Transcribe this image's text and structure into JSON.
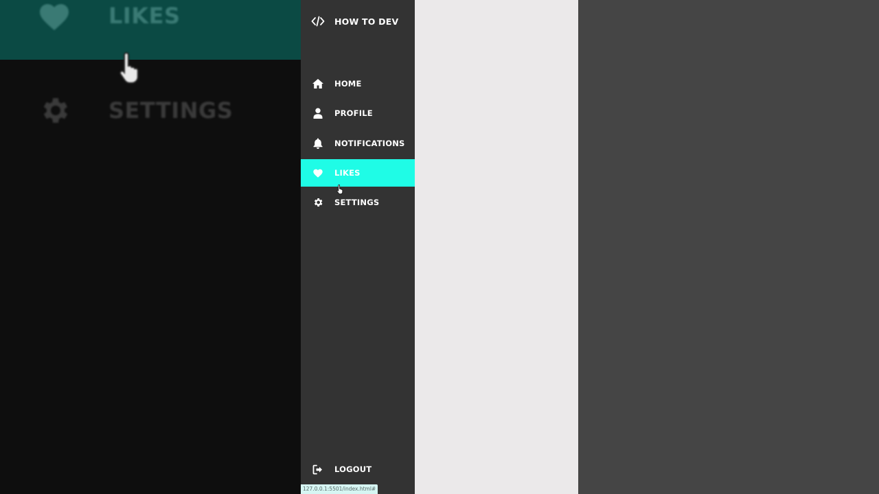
{
  "brand": {
    "label": "HOW TO DEV",
    "icon": "code-icon"
  },
  "nav": {
    "items": [
      {
        "label": "HOME",
        "icon": "home-icon",
        "active": false
      },
      {
        "label": "PROFILE",
        "icon": "user-icon",
        "active": false
      },
      {
        "label": "NOTIFICATIONS",
        "icon": "bell-icon",
        "active": false
      },
      {
        "label": "LIKES",
        "icon": "heart-icon",
        "active": true
      },
      {
        "label": "SETTINGS",
        "icon": "gear-icon",
        "active": false
      }
    ]
  },
  "logout": {
    "label": "LOGOUT",
    "icon": "logout-icon"
  },
  "backdrop": {
    "likes_label": "LIKES",
    "settings_label": "SETTINGS"
  },
  "status_bar": {
    "url": "127.0.0.1:5501/index.html#"
  },
  "colors": {
    "sidebar_bg": "#333333",
    "accent": "#1ffce6",
    "content_bg": "#ebe9ea",
    "page_bg": "#454545"
  }
}
